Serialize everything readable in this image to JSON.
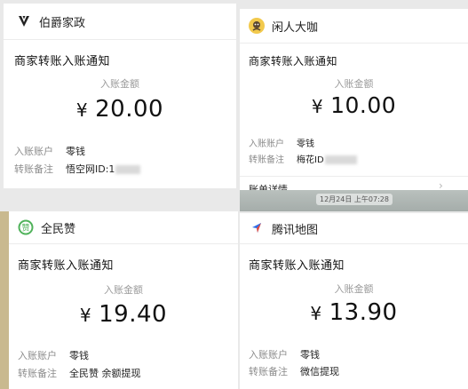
{
  "notices": [
    {
      "app_name": "伯爵家政",
      "title": "商家转账入账通知",
      "amount_label": "入账金额",
      "currency": "¥",
      "amount": "20.00",
      "account_label": "入账账户",
      "account_value": "零钱",
      "remark_label": "转账备注",
      "remark_value": "悟空网ID:1",
      "icon": "v-shield-icon"
    },
    {
      "app_name": "闲人大咖",
      "title": "商家转账入账通知",
      "amount_label": "入账金额",
      "currency": "¥",
      "amount": "10.00",
      "account_label": "入账账户",
      "account_value": "零钱",
      "remark_label": "转账备注",
      "remark_value": "梅花ID",
      "detail_label": "账单详情",
      "timestamp": "12月24日 上午07:28",
      "icon": "avatar-icon"
    },
    {
      "app_name": "全民赞",
      "title": "商家转账入账通知",
      "amount_label": "入账金额",
      "currency": "¥",
      "amount": "19.40",
      "account_label": "入账账户",
      "account_value": "零钱",
      "remark_label": "转账备注",
      "remark_value": "全民赞 余额提现",
      "icon": "zan-icon"
    },
    {
      "app_name": "腾讯地图",
      "title": "商家转账入账通知",
      "amount_label": "入账金额",
      "currency": "¥",
      "amount": "13.90",
      "account_label": "入账账户",
      "account_value": "零钱",
      "remark_label": "转账备注",
      "remark_value": "微信提现",
      "icon": "map-pin-icon"
    }
  ],
  "colors": {
    "zan_green": "#4fb25a",
    "map_blue": "#2f6fe8",
    "map_red": "#e94b3c",
    "avatar_yellow": "#f2c94c"
  }
}
